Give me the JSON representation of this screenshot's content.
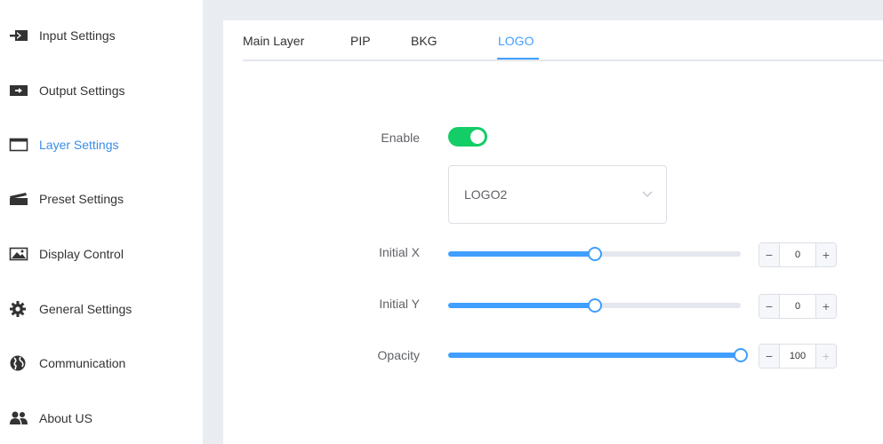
{
  "sidebar": {
    "items": [
      {
        "label": "Input Settings",
        "icon": "input-icon",
        "active": false
      },
      {
        "label": "Output Settings",
        "icon": "output-icon",
        "active": false
      },
      {
        "label": "Layer Settings",
        "icon": "layer-icon",
        "active": true
      },
      {
        "label": "Preset Settings",
        "icon": "clapperboard-icon",
        "active": false
      },
      {
        "label": "Display Control",
        "icon": "image-icon",
        "active": false
      },
      {
        "label": "General Settings",
        "icon": "gear-icon",
        "active": false
      },
      {
        "label": "Communication",
        "icon": "globe-icon",
        "active": false
      },
      {
        "label": "About US",
        "icon": "users-icon",
        "active": false
      }
    ]
  },
  "tabs": {
    "items": [
      {
        "label": "Main Layer",
        "active": false
      },
      {
        "label": "PIP",
        "active": false
      },
      {
        "label": "BKG",
        "active": false
      },
      {
        "label": "LOGO",
        "active": true
      }
    ]
  },
  "form": {
    "enable_label": "Enable",
    "enable_on": true,
    "logo_select": {
      "value": "LOGO2"
    },
    "initial_x": {
      "label": "Initial X",
      "value": "0",
      "level_percent": 50
    },
    "initial_y": {
      "label": "Initial Y",
      "value": "0",
      "level_percent": 50
    },
    "opacity": {
      "label": "Opacity",
      "value": "100",
      "level_percent": 100
    },
    "stepper_minus": "−",
    "stepper_plus": "+"
  },
  "colors": {
    "accent": "#409eff",
    "toggle_on": "#13ce66",
    "active_nav": "#3a8ee6"
  }
}
